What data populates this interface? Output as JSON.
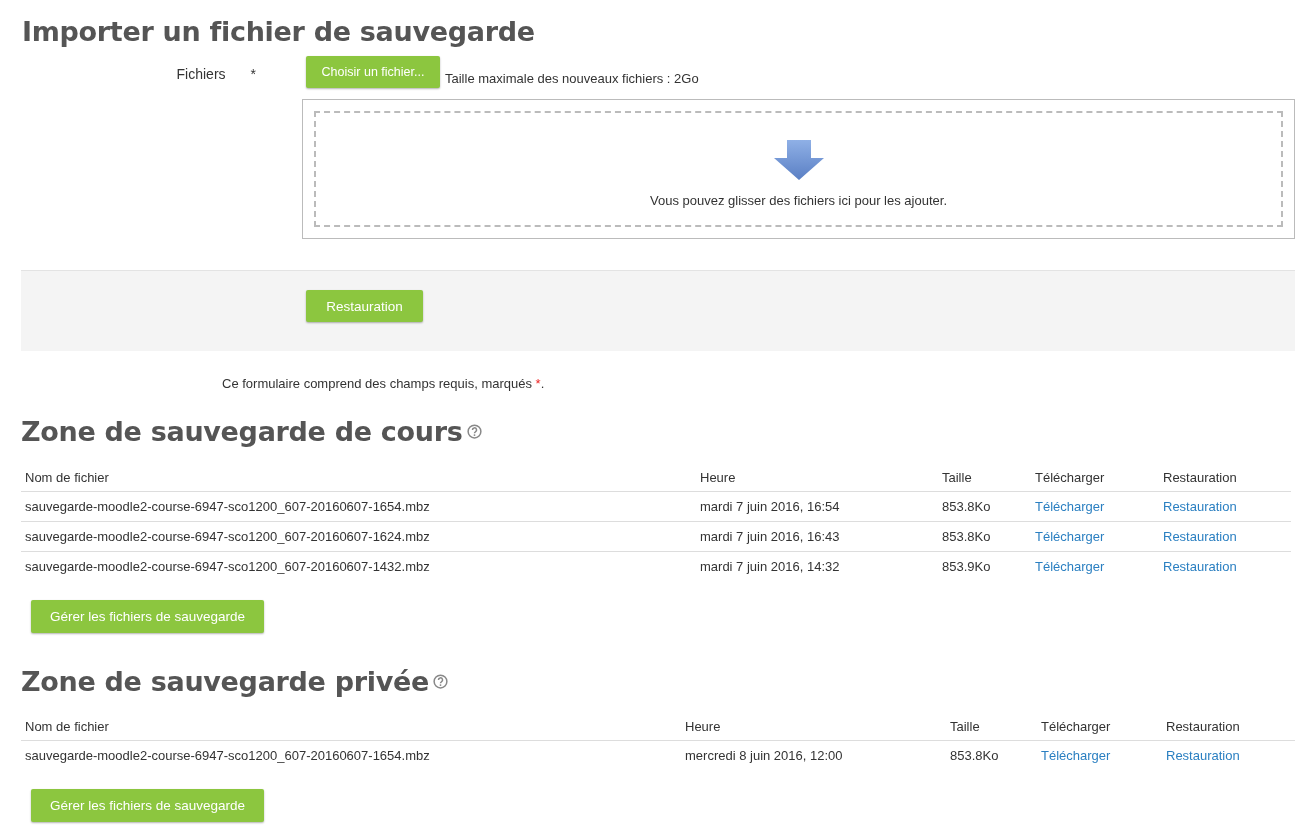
{
  "import_section": {
    "title": "Importer un fichier de sauvegarde",
    "files_label": "Fichiers",
    "required_marker": "*",
    "choose_button": "Choisir un fichier...",
    "max_size": "Taille maximale des nouveaux fichiers : 2Go",
    "dropzone_text": "Vous pouvez glisser des fichiers ici pour les ajouter.",
    "submit_button": "Restauration",
    "required_note": {
      "text": "Ce formulaire comprend des champs requis, marqués ",
      "mark": "*",
      "end": "."
    }
  },
  "backup_areas": [
    {
      "title": "Zone de sauvegarde de cours",
      "columns": [
        "Nom de fichier",
        "Heure",
        "Taille",
        "Télécharger",
        "Restauration"
      ],
      "rows": [
        {
          "filename": "sauvegarde-moodle2-course-6947-sco1200_607-20160607-1654.mbz",
          "time": "mardi 7 juin 2016, 16:54",
          "size": "853.8Ko",
          "download": "Télécharger",
          "restore": "Restauration"
        },
        {
          "filename": "sauvegarde-moodle2-course-6947-sco1200_607-20160607-1624.mbz",
          "time": "mardi 7 juin 2016, 16:43",
          "size": "853.8Ko",
          "download": "Télécharger",
          "restore": "Restauration"
        },
        {
          "filename": "sauvegarde-moodle2-course-6947-sco1200_607-20160607-1432.mbz",
          "time": "mardi 7 juin 2016, 14:32",
          "size": "853.9Ko",
          "download": "Télécharger",
          "restore": "Restauration"
        }
      ],
      "manage_button": "Gérer les fichiers de sauvegarde"
    },
    {
      "title": "Zone de sauvegarde privée",
      "columns": [
        "Nom de fichier",
        "Heure",
        "Taille",
        "Télécharger",
        "Restauration"
      ],
      "rows": [
        {
          "filename": "sauvegarde-moodle2-course-6947-sco1200_607-20160607-1654.mbz",
          "time": "mercredi 8 juin 2016, 12:00",
          "size": "853.8Ko",
          "download": "Télécharger",
          "restore": "Restauration"
        }
      ],
      "manage_button": "Gérer les fichiers de sauvegarde"
    }
  ]
}
